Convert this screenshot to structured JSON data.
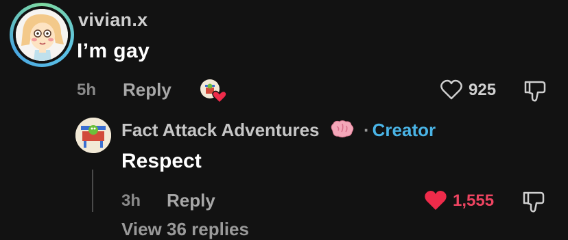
{
  "comment": {
    "username": "vivian.x",
    "text": "I’m gay",
    "time": "5h",
    "reply_label": "Reply",
    "like_count": "925"
  },
  "reply": {
    "author": "Fact Attack Adventures",
    "author_badge_icon": "brain-icon",
    "separator": "·",
    "creator_label": "Creator",
    "text": "Respect",
    "time": "3h",
    "reply_label": "Reply",
    "like_count": "1,555",
    "liked": true
  },
  "view_replies": "View 36 replies",
  "colors": {
    "background": "#121212",
    "creator_blue": "#4ab4e6",
    "liked_red": "#ee4461"
  }
}
